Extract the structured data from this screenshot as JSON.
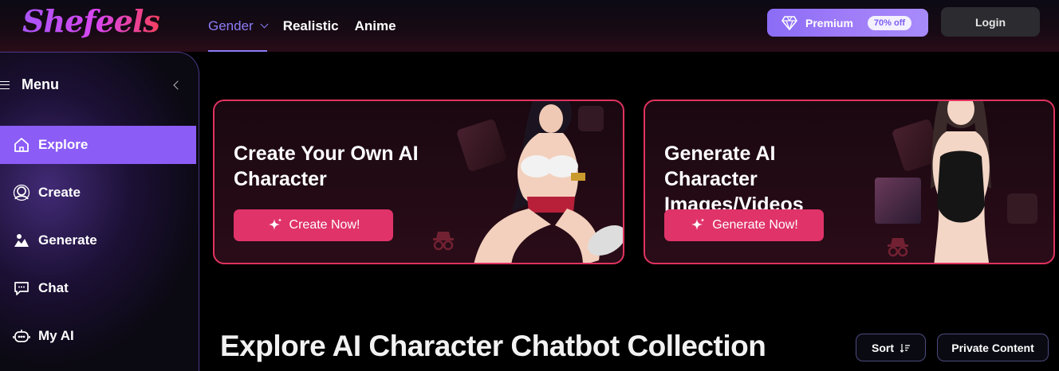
{
  "header": {
    "logo_text": "Shefeels",
    "nav": [
      {
        "label": "Gender",
        "active": true
      },
      {
        "label": "Realistic",
        "active": false
      },
      {
        "label": "Anime",
        "active": false
      }
    ],
    "premium": {
      "label": "Premium",
      "badge": "70% off"
    },
    "login_label": "Login"
  },
  "sidebar": {
    "title": "Menu",
    "items": [
      {
        "label": "Explore",
        "icon": "home-icon",
        "active": true
      },
      {
        "label": "Create",
        "icon": "create-avatar-icon",
        "active": false
      },
      {
        "label": "Generate",
        "icon": "generate-image-icon",
        "active": false
      },
      {
        "label": "Chat",
        "icon": "chat-bubble-icon",
        "active": false
      },
      {
        "label": "My AI",
        "icon": "robot-icon",
        "active": false
      }
    ]
  },
  "banners": [
    {
      "title": "Create Your Own AI Character",
      "button": "Create Now!"
    },
    {
      "title": "Generate AI Character Images/Videos",
      "button": "Generate Now!"
    }
  ],
  "explore": {
    "title": "Explore AI Character Chatbot Collection",
    "sort_label": "Sort",
    "private_label": "Private Content"
  },
  "colors": {
    "accent_purple": "#8b5cf6",
    "accent_pink": "#e0336a",
    "card_border": "#e0335f"
  }
}
